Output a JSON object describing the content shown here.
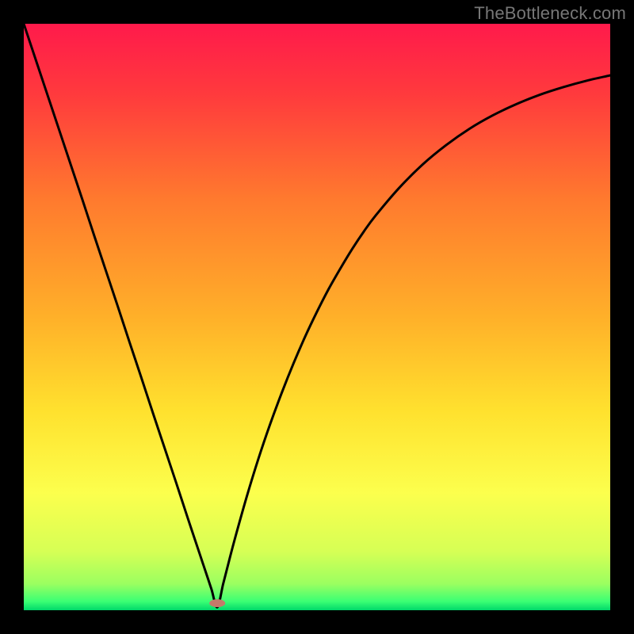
{
  "watermark": "TheBottleneck.com",
  "chart_data": {
    "type": "line",
    "title": "",
    "xlabel": "",
    "ylabel": "",
    "xlim": [
      0,
      100
    ],
    "ylim": [
      0,
      100
    ],
    "optimum_x": 33,
    "gradient_stops": [
      {
        "offset": 0.0,
        "color": "#ff1a4b"
      },
      {
        "offset": 0.12,
        "color": "#ff3a3d"
      },
      {
        "offset": 0.3,
        "color": "#ff7a2e"
      },
      {
        "offset": 0.5,
        "color": "#ffb029"
      },
      {
        "offset": 0.66,
        "color": "#ffe12e"
      },
      {
        "offset": 0.8,
        "color": "#fcff4d"
      },
      {
        "offset": 0.9,
        "color": "#d6ff55"
      },
      {
        "offset": 0.955,
        "color": "#9bff60"
      },
      {
        "offset": 0.985,
        "color": "#3bff74"
      },
      {
        "offset": 1.0,
        "color": "#00d86a"
      }
    ],
    "marker": {
      "x": 33,
      "y": 1.2,
      "rx": 10,
      "ry": 5,
      "color": "#c47a6a"
    },
    "series": [
      {
        "name": "bottleneck-curve",
        "x": [
          0,
          2,
          4,
          6,
          8,
          10,
          12,
          14,
          16,
          18,
          20,
          22,
          24,
          26,
          28,
          30,
          31,
          32,
          33,
          34,
          35,
          36,
          38,
          40,
          42,
          44,
          46,
          48,
          50,
          52,
          54,
          56,
          58,
          60,
          64,
          68,
          72,
          76,
          80,
          84,
          88,
          92,
          96,
          100
        ],
        "y": [
          100,
          94,
          88,
          82,
          76,
          70,
          63.9,
          57.9,
          51.9,
          45.8,
          39.8,
          33.7,
          27.7,
          21.7,
          15.6,
          9.6,
          6.6,
          3.6,
          0.5,
          4.5,
          8.4,
          12.2,
          19.3,
          25.8,
          31.7,
          37.1,
          42.1,
          46.7,
          50.9,
          54.8,
          58.3,
          61.6,
          64.6,
          67.3,
          72.0,
          76.0,
          79.3,
          82.1,
          84.4,
          86.3,
          87.9,
          89.2,
          90.3,
          91.2
        ]
      }
    ]
  }
}
